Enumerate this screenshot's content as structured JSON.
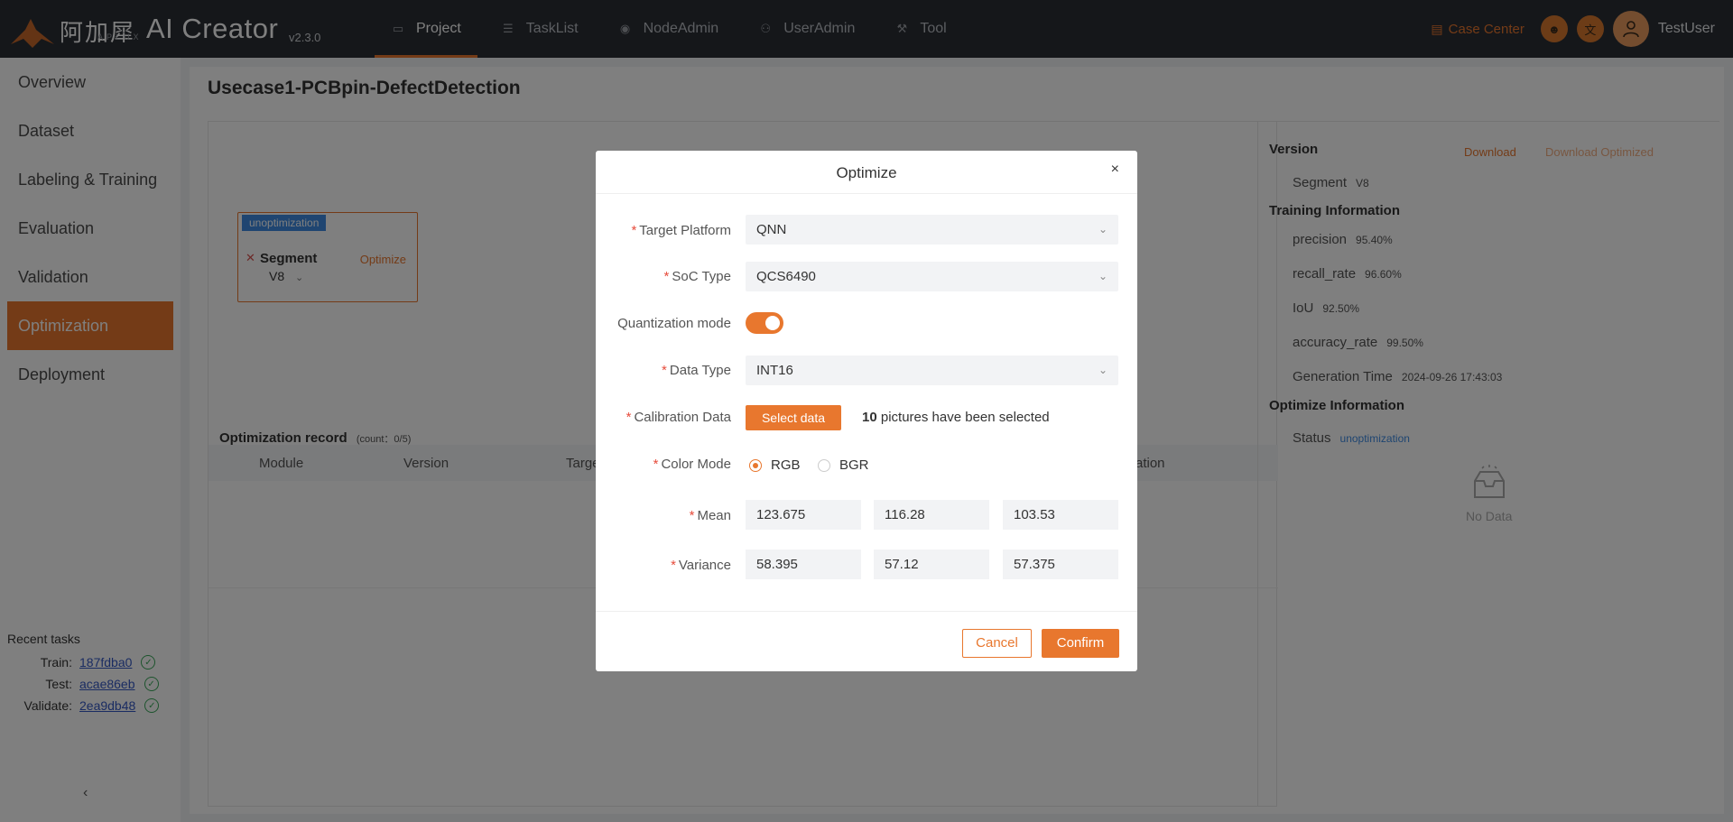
{
  "app": {
    "logo_cn": "阿加犀",
    "logo_sub": "APLUX",
    "title": "AI Creator",
    "version": "v2.3.0"
  },
  "nav": [
    {
      "label": "Project",
      "icon": "folder-icon"
    },
    {
      "label": "TaskList",
      "icon": "list-icon"
    },
    {
      "label": "NodeAdmin",
      "icon": "node-icon"
    },
    {
      "label": "UserAdmin",
      "icon": "user-group-icon"
    },
    {
      "label": "Tool",
      "icon": "tool-icon"
    }
  ],
  "header_right": {
    "case_center": "Case Center",
    "username": "TestUser"
  },
  "sidebar": {
    "items": [
      "Overview",
      "Dataset",
      "Labeling & Training",
      "Evaluation",
      "Validation",
      "Optimization",
      "Deployment"
    ],
    "active": "Optimization",
    "recent_title": "Recent tasks",
    "recent": [
      {
        "label": "Train:",
        "id": "187fdba0"
      },
      {
        "label": "Test:",
        "id": "acae86eb"
      },
      {
        "label": "Validate:",
        "id": "2ea9db48"
      }
    ],
    "collapse": "‹"
  },
  "main": {
    "title": "Usecase1-PCBpin-DefectDetection",
    "node": {
      "badge": "unoptimization",
      "name": "Segment",
      "version": "V8",
      "action": "Optimize"
    },
    "record": {
      "title": "Optimization record",
      "count": "(count：0/5)",
      "columns": [
        "Module",
        "Version",
        "Targe",
        "ration"
      ]
    }
  },
  "right_panel": {
    "version_title": "Version",
    "download": "Download",
    "download_optimized": "Download Optimized",
    "segment_label": "Segment",
    "segment_value": "V8",
    "training_title": "Training Information",
    "training": [
      {
        "label": "precision",
        "value": "95.40%"
      },
      {
        "label": "recall_rate",
        "value": "96.60%"
      },
      {
        "label": "IoU",
        "value": "92.50%"
      },
      {
        "label": "accuracy_rate",
        "value": "99.50%"
      },
      {
        "label": "Generation Time",
        "value": "2024-09-26 17:43:03"
      }
    ],
    "optimize_title": "Optimize Information",
    "status_label": "Status",
    "status_value": "unoptimization",
    "no_data": "No Data"
  },
  "modal": {
    "title": "Optimize",
    "close": "×",
    "target_platform_label": "Target Platform",
    "target_platform_value": "QNN",
    "soc_label": "SoC Type",
    "soc_value": "QCS6490",
    "quant_label": "Quantization mode",
    "quant_on": true,
    "data_type_label": "Data Type",
    "data_type_value": "INT16",
    "calib_label": "Calibration Data",
    "calib_button": "Select data",
    "calib_count": "10",
    "calib_info": "pictures have been selected",
    "color_label": "Color Mode",
    "color_options": [
      "RGB",
      "BGR"
    ],
    "color_selected": "RGB",
    "mean_label": "Mean",
    "mean": [
      "123.675",
      "116.28",
      "103.53"
    ],
    "variance_label": "Variance",
    "variance": [
      "58.395",
      "57.12",
      "57.375"
    ],
    "cancel": "Cancel",
    "confirm": "Confirm"
  },
  "colors": {
    "accent": "#e8772e",
    "topbar": "#2a2e35",
    "badge_blue": "#3e8be2"
  }
}
